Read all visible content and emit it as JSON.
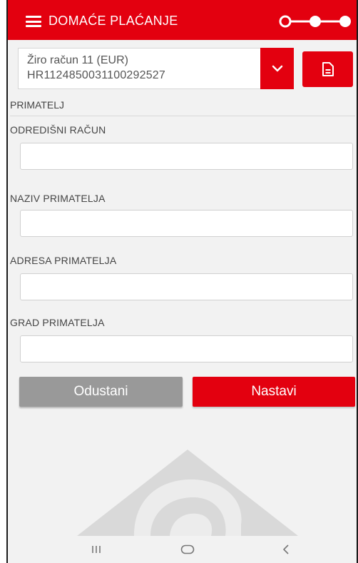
{
  "header": {
    "title": "DOMAĆE PLAĆANJE",
    "menu_icon": "hamburger-menu-icon",
    "progress_icon": "step-progress-icon",
    "progress_current_step": 1,
    "progress_total_steps": 3
  },
  "account": {
    "name": "Žiro račun 11 (EUR)",
    "iban": "HR1124850031100292527",
    "dropdown_icon": "chevron-down-icon",
    "doc_icon": "document-icon"
  },
  "section": {
    "title": "PRIMATELJ"
  },
  "fields": [
    {
      "label": "ODREDIŠNI RAČUN",
      "value": "",
      "placeholder": ""
    },
    {
      "label": "NAZIV PRIMATELJA",
      "value": "",
      "placeholder": ""
    },
    {
      "label": "ADRESA PRIMATELJA",
      "value": "",
      "placeholder": ""
    },
    {
      "label": "GRAD PRIMATELJA",
      "value": "",
      "placeholder": ""
    }
  ],
  "actions": {
    "cancel_label": "Odustani",
    "next_label": "Nastavi"
  },
  "colors": {
    "primary": "#e3000f",
    "secondary_button": "#999999",
    "background": "#f2f2f2"
  },
  "navbar": {
    "recents_icon": "recent-apps-icon",
    "home_icon": "home-icon",
    "back_icon": "back-icon"
  }
}
